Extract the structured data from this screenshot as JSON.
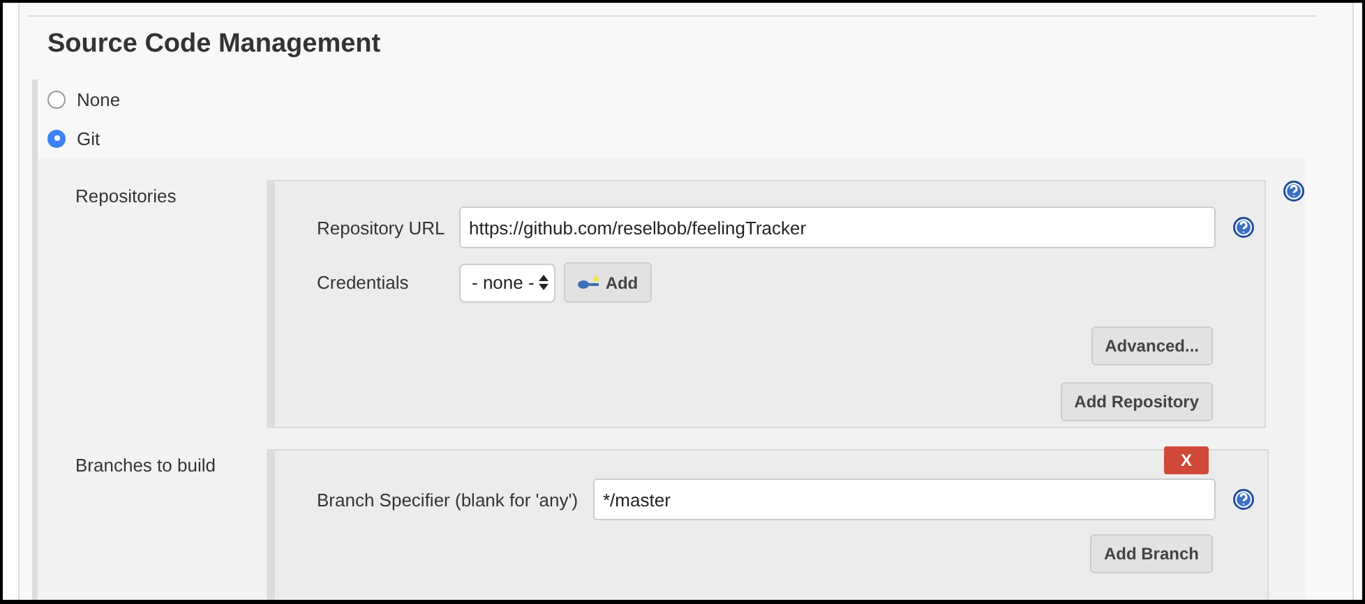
{
  "section_title": "Source Code Management",
  "scm_options": [
    {
      "label": "None",
      "selected": false
    },
    {
      "label": "Git",
      "selected": true
    }
  ],
  "repositories": {
    "label": "Repositories",
    "url_label": "Repository URL",
    "url_value": "https://github.com/reselbob/feelingTracker",
    "credentials_label": "Credentials",
    "credentials_value": "- none -",
    "add_button": "Add",
    "advanced_button": "Advanced...",
    "add_repository_button": "Add Repository"
  },
  "branches": {
    "label": "Branches to build",
    "delete_button": "X",
    "specifier_label": "Branch Specifier (blank for 'any')",
    "specifier_value": "*/master",
    "add_branch_button": "Add Branch"
  }
}
